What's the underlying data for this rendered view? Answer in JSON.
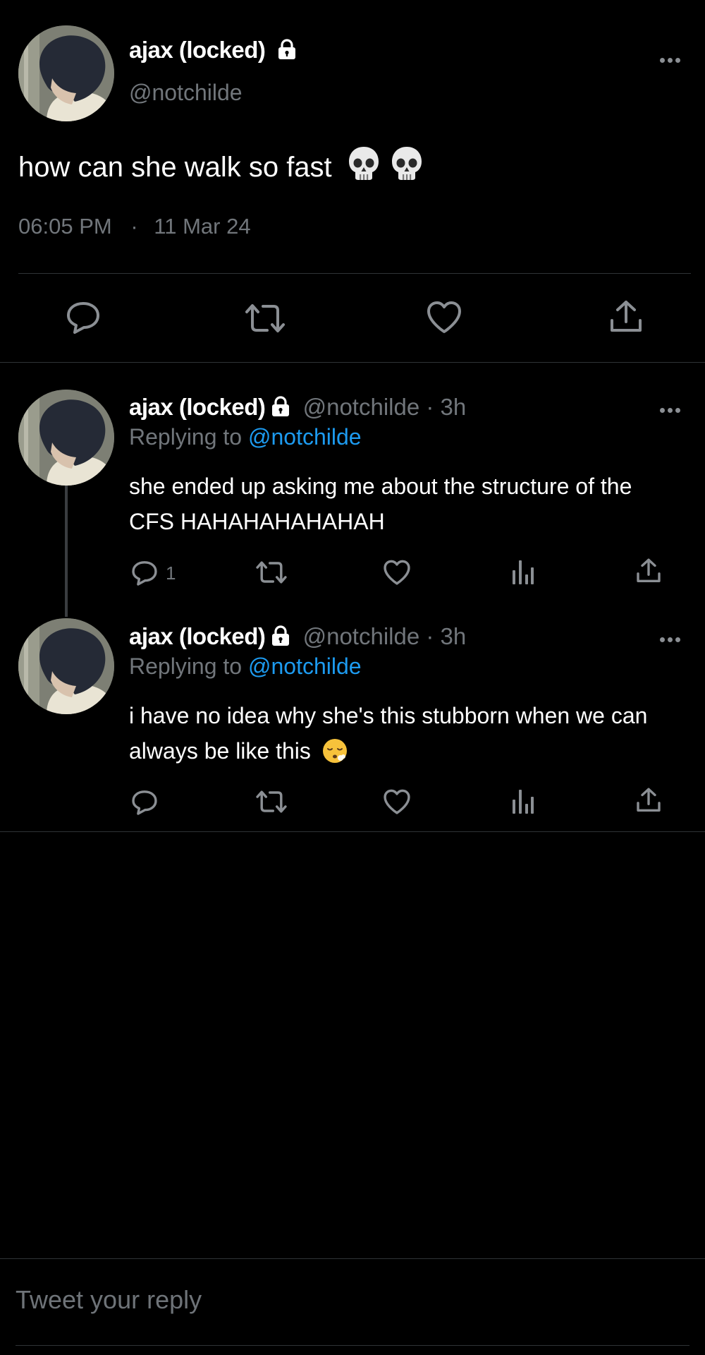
{
  "main_tweet": {
    "display_name": "ajax (locked)",
    "handle": "@notchilde",
    "text": "how can she walk so fast",
    "emoji": [
      "skull",
      "skull"
    ],
    "time": "06:05 PM",
    "separator": "·",
    "date": "11 Mar 24"
  },
  "replies": [
    {
      "display_name": "ajax (locked)",
      "handle_time": "@notchilde · 3h",
      "replying_label": "Replying to",
      "replying_handle": "@notchilde",
      "text_line1": "she ended up asking me about the structure of the",
      "text_line2": "CFS HAHAHAHAHAHAH",
      "reply_count": "1"
    },
    {
      "display_name": "ajax (locked)",
      "handle_time": "@notchilde · 3h",
      "replying_label": "Replying to",
      "replying_handle": "@notchilde",
      "text_line1": "i have no idea why she's this stubborn when we can",
      "text_line2": "always be like this",
      "emoji": "face-exhaling",
      "reply_count": ""
    }
  ],
  "reply_box": {
    "placeholder": "Tweet your reply"
  },
  "icons": {
    "reply": "reply-icon",
    "retweet": "retweet-icon",
    "like": "heart-icon",
    "views": "views-icon",
    "share": "share-icon",
    "lock": "lock-icon",
    "more": "more-icon"
  },
  "colors": {
    "background": "#000000",
    "text": "#e7e9ea",
    "secondary": "#71767b",
    "link": "#1d9bf0",
    "divider": "#2f3336"
  }
}
